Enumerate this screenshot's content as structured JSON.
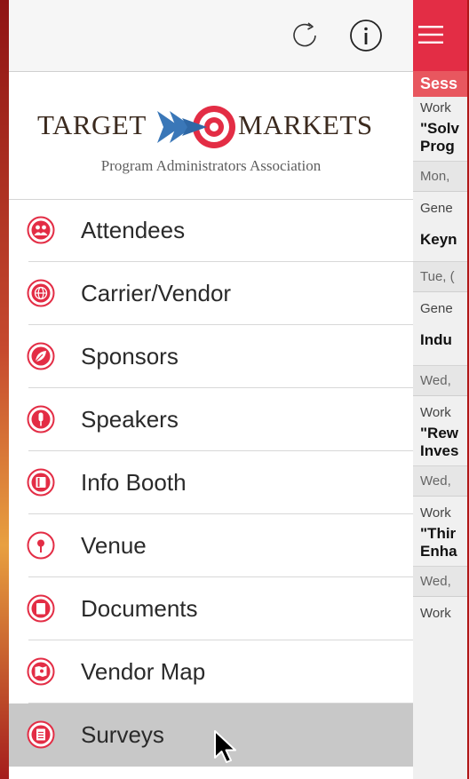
{
  "logo": {
    "word_left": "TARGET",
    "word_right": "MARKETS",
    "tagline": "Program Administrators Association",
    "mark_colors": {
      "arrow": "#3a77b8",
      "target": "#e32d45"
    }
  },
  "toolbar": {
    "refresh_icon": "refresh-icon",
    "info_icon": "info-icon"
  },
  "menu": {
    "items": [
      {
        "label": "Attendees",
        "icon": "people-icon"
      },
      {
        "label": "Carrier/Vendor",
        "icon": "globe-icon"
      },
      {
        "label": "Sponsors",
        "icon": "leaf-icon"
      },
      {
        "label": "Speakers",
        "icon": "microphone-icon"
      },
      {
        "label": "Info Booth",
        "icon": "book-icon"
      },
      {
        "label": "Venue",
        "icon": "map-pin-icon"
      },
      {
        "label": "Documents",
        "icon": "document-icon"
      },
      {
        "label": "Vendor Map",
        "icon": "map-icon"
      },
      {
        "label": "Surveys",
        "icon": "clipboard-icon"
      }
    ],
    "active_index": 8
  },
  "panel": {
    "section": "Sess",
    "items": [
      {
        "type": "Work",
        "title": [
          "\"Solv",
          "Prog"
        ],
        "date": "Mon,"
      },
      {
        "type": "Gene",
        "title": [
          "Keyn"
        ],
        "date": "Tue, ("
      },
      {
        "type": "Gene",
        "title": [
          "Indu"
        ],
        "date": "Wed,"
      },
      {
        "type": "Work",
        "title": [
          "\"Rew",
          "Inves"
        ],
        "date": "Wed,"
      },
      {
        "type": "Work",
        "title": [
          "\"Thir",
          "Enha"
        ],
        "date": "Wed,"
      },
      {
        "type": "Work",
        "title": [],
        "date": ""
      }
    ]
  },
  "colors": {
    "accent": "#e32d45",
    "section": "#e8575f",
    "active_row": "#c8c8c8"
  }
}
